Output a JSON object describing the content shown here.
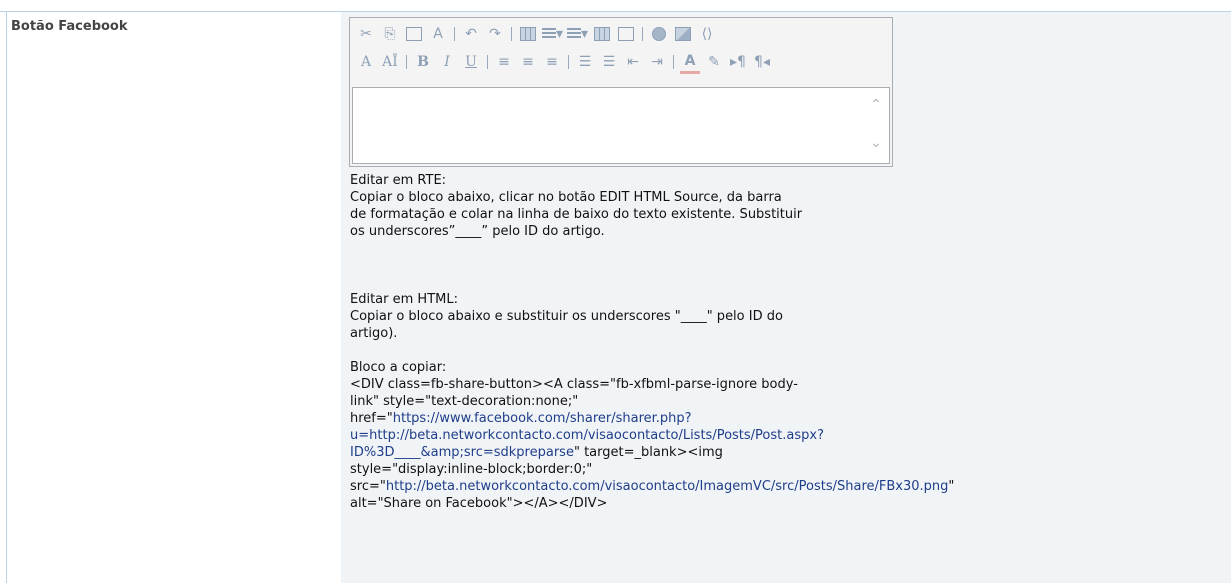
{
  "field": {
    "label": "Botão Facebook"
  },
  "toolbar": {
    "row1": [
      {
        "icon": "cut-icon",
        "glyph": "✂"
      },
      {
        "icon": "copy-icon",
        "glyph": "⎘"
      },
      {
        "icon": "paste-icon",
        "glyph": "📋"
      },
      {
        "icon": "spellcheck-icon",
        "glyph": "A"
      },
      {
        "icon": "undo-icon",
        "glyph": "↶"
      },
      {
        "icon": "redo-icon",
        "glyph": "↷"
      },
      {
        "icon": "table-icon",
        "glyph": ""
      },
      {
        "icon": "insert-row-icon",
        "glyph": "▾"
      },
      {
        "icon": "insert-column-icon",
        "glyph": "▾"
      },
      {
        "icon": "grid-icon",
        "glyph": ""
      },
      {
        "icon": "table-properties-icon",
        "glyph": ""
      },
      {
        "icon": "hyperlink-icon",
        "glyph": ""
      },
      {
        "icon": "image-icon",
        "glyph": ""
      },
      {
        "icon": "html-source-icon",
        "glyph": "⟨⟩"
      }
    ],
    "row2": [
      {
        "icon": "font-name-icon",
        "glyph": "A"
      },
      {
        "icon": "font-size-icon",
        "glyph": "AĪ"
      },
      {
        "icon": "bold-icon",
        "glyph": "B"
      },
      {
        "icon": "italic-icon",
        "glyph": "I"
      },
      {
        "icon": "underline-icon",
        "glyph": "U"
      },
      {
        "icon": "align-left-icon",
        "glyph": "≡"
      },
      {
        "icon": "align-center-icon",
        "glyph": "≡"
      },
      {
        "icon": "align-right-icon",
        "glyph": "≡"
      },
      {
        "icon": "ordered-list-icon",
        "glyph": "☰"
      },
      {
        "icon": "bullet-list-icon",
        "glyph": "☰"
      },
      {
        "icon": "outdent-icon",
        "glyph": "⇤"
      },
      {
        "icon": "indent-icon",
        "glyph": "⇥"
      },
      {
        "icon": "font-color-icon",
        "glyph": "A"
      },
      {
        "icon": "highlight-icon",
        "glyph": "✎"
      },
      {
        "icon": "ltr-icon",
        "glyph": "▸¶"
      },
      {
        "icon": "rtl-icon",
        "glyph": "¶◂"
      }
    ]
  },
  "help": {
    "rte_title": "Editar em RTE:",
    "rte_line1": "Copiar o bloco abaixo, clicar no botão EDIT HTML Source, da barra",
    "rte_line2": "de formatação e colar na linha de baixo do texto existente. Substituir",
    "rte_line3": "os underscores”____” pelo ID do artigo.",
    "html_title": "Editar em HTML:",
    "html_line1": "Copiar o bloco abaixo e substituir os underscores \"____\" pelo  ID do",
    "html_line2": "artigo).",
    "block_title": "Bloco a copiar:",
    "code1": "<DIV class=fb-share-button><A class=\"fb-xfbml-parse-ignore body-",
    "code2": "link\" style=\"text-decoration:none;\"",
    "code3_prefix": "href=\"",
    "code3_link": "https://www.facebook.com/sharer/sharer.php?",
    "code4_link": "u=http://beta.networkcontacto.com/visaocontacto/Lists/Posts/Post.aspx?",
    "code5_link": "ID%3D____&amp;src=sdkpreparse",
    "code5_suffix": "\" target=_blank><img",
    "code6": "style=\"display:inline-block;border:0;\"",
    "code7_prefix": "src=\"",
    "code7_link": "http://beta.networkcontacto.com/visaocontacto/ImagemVC/src/Posts/Share/FBx30.png",
    "code7_suffix": "\"",
    "code8": "alt=\"Share on Facebook\"></A></DIV>"
  },
  "colors": {
    "field_background": "#f1f4f7",
    "frame_line": "#b8d3e6",
    "link": "#1f3e8a",
    "toolbar_icon": "#8ea0b6"
  }
}
